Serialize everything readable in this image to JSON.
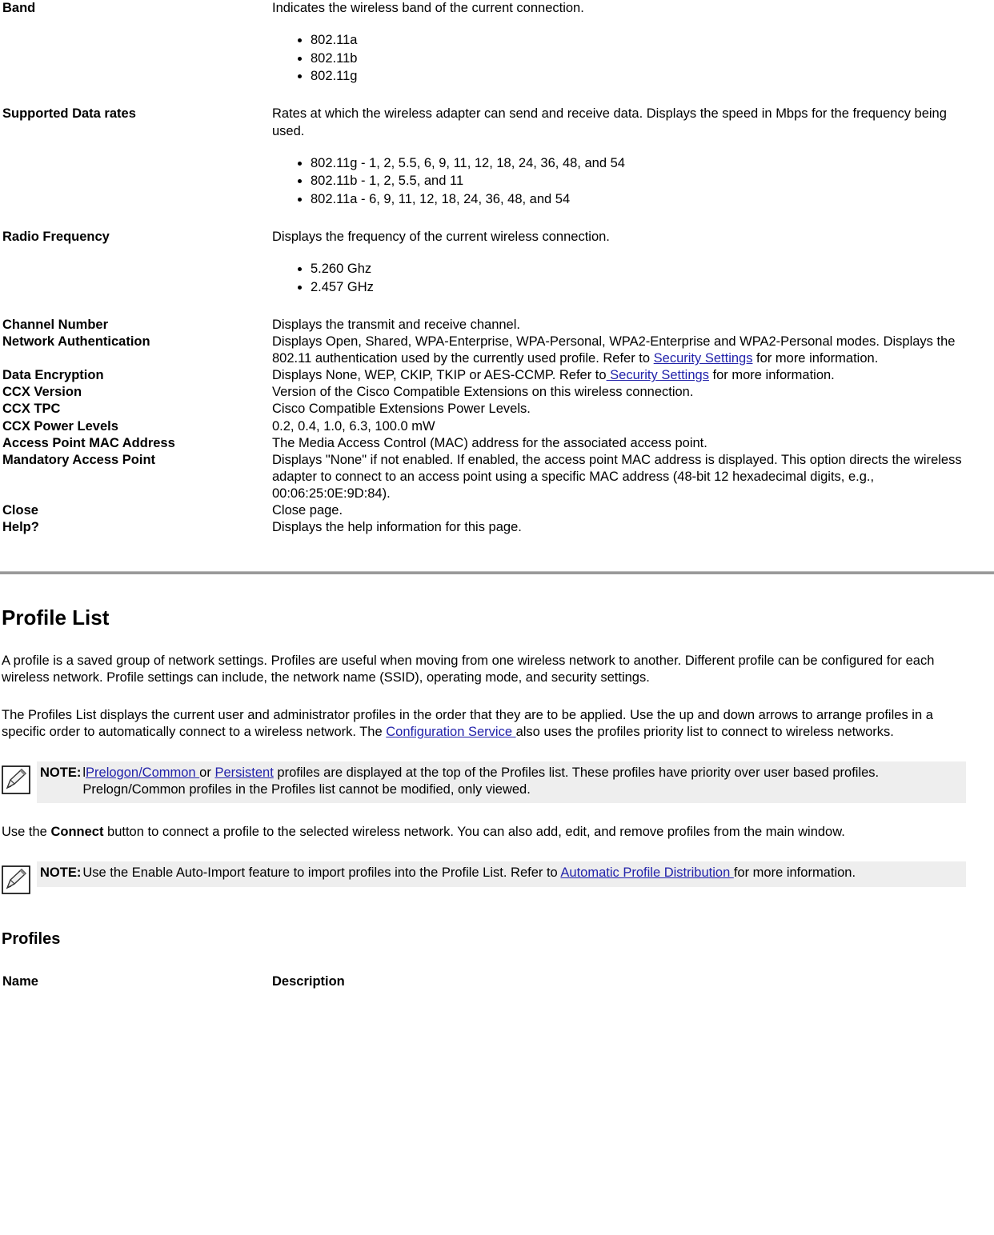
{
  "definitions": [
    {
      "term": "Band",
      "desc": "Indicates the wireless band of the current connection.",
      "bullets": [
        "802.11a",
        "802.11b",
        "802.11g"
      ]
    },
    {
      "term": "Supported Data rates",
      "desc": "Rates at which the wireless adapter can send and receive data. Displays the speed in Mbps for the frequency being used.",
      "bullets": [
        "802.11g - 1, 2, 5.5, 6, 9, 11, 12, 18, 24, 36, 48, and 54",
        "802.11b - 1, 2, 5.5, and 11",
        "802.11a - 6, 9, 11, 12, 18, 24, 36, 48, and 54"
      ]
    },
    {
      "term": "Radio Frequency",
      "desc": "Displays the frequency of the current wireless connection.",
      "bullets": [
        "5.260 Ghz",
        "2.457 GHz"
      ]
    },
    {
      "term": "Channel Number",
      "desc": "Displays the transmit and receive channel."
    },
    {
      "term": "Network Authentication",
      "desc_pre": "Displays Open, Shared, WPA-Enterprise, WPA-Personal, WPA2-Enterprise and WPA2-Personal modes. Displays the 802.11 authentication used by the currently used profile. Refer to ",
      "link": "Security Settings",
      "desc_post": " for more information."
    },
    {
      "term": "Data Encryption",
      "desc_pre": "Displays None, WEP, CKIP, TKIP or AES-CCMP. Refer to",
      "link": " Security Settings",
      "desc_post": " for more information."
    },
    {
      "term": "CCX Version",
      "desc": "Version of the Cisco Compatible Extensions on this wireless connection."
    },
    {
      "term": "CCX TPC",
      "desc": "Cisco Compatible Extensions Power Levels."
    },
    {
      "term": "CCX Power Levels",
      "desc": "0.2, 0.4, 1.0, 6.3, 100.0 mW"
    },
    {
      "term": "Access Point MAC Address",
      "desc": "The Media Access Control (MAC) address for the associated access point."
    },
    {
      "term": "Mandatory Access Point",
      "desc": "Displays \"None\" if not enabled. If enabled, the access point MAC address is displayed. This option directs the wireless adapter to connect to an access point using a specific MAC address (48-bit 12 hexadecimal digits, e.g., 00:06:25:0E:9D:84)."
    },
    {
      "term": "Close",
      "desc": "Close page."
    },
    {
      "term": "Help?",
      "desc": "Displays the help information for this page."
    }
  ],
  "profile_list": {
    "title": "Profile List",
    "para1": "A profile is a saved group of network settings. Profiles are useful when moving from one wireless network to another. Different profile can be configured for each wireless network. Profile settings can include, the network name (SSID), operating mode, and security settings.",
    "para2_pre": "The Profiles List displays the current user and administrator profiles in the order that they are to be applied. Use the up and down arrows to arrange profiles in a specific order to automatically connect to a wireless network. The ",
    "para2_link": "Configuration Service ",
    "para2_post": "also uses the profiles priority list to connect to wireless networks.",
    "note1": {
      "label": "NOTE:",
      "pre": "l",
      "link1": "Prelogon/Common ",
      "mid": "or ",
      "link2": "Persistent",
      "post": " profiles are displayed at the top of the Profiles list. These profiles have priority over user based profiles. Prelogn/Common profiles in the Profiles list cannot be modified, only viewed."
    },
    "para3_pre": "Use the ",
    "para3_bold": "Connect",
    "para3_post": " button to connect a profile to the selected wireless network. You can also add, edit, and remove profiles from the main window.",
    "note2": {
      "label": "NOTE:",
      "pre": "Use the Enable Auto-Import feature to import profiles into the Profile List. Refer to ",
      "link": "Automatic Profile Distribution ",
      "post": "for more information."
    },
    "profiles_heading": "Profiles",
    "col_name": "Name",
    "col_description": "Description"
  }
}
